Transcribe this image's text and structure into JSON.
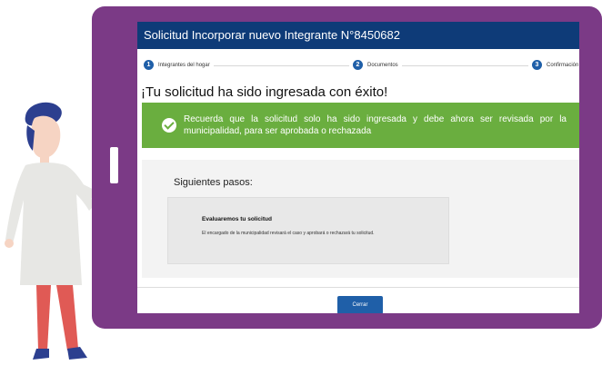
{
  "window": {
    "title": "Solicitud Incorporar nuevo Integrante N°8450682"
  },
  "stepper": {
    "steps": [
      {
        "number": "1",
        "label": "Integrantes del hogar"
      },
      {
        "number": "2",
        "label": "Documentos"
      },
      {
        "number": "3",
        "label": "Confirmación"
      }
    ]
  },
  "main": {
    "headline": "¡Tu solicitud ha sido ingresada con éxito!",
    "alert_text": "Recuerda que la solicitud solo ha sido ingresada y debe ahora ser revisada por la municipalidad, para ser aprobada o rechazada",
    "next_steps_title": "Siguientes pasos:",
    "card": {
      "title": "Evaluaremos tu solicitud",
      "text": "El encargado de la municipalidad revisará el caso y aprobará o rechazará tu solicitud."
    }
  },
  "footer": {
    "close_label": "Cerrar"
  },
  "colors": {
    "tablet": "#7b3a86",
    "titlebar": "#0e3b78",
    "success": "#6aae3f",
    "step_accent": "#1f5fa8"
  },
  "icons": [
    "check-circle-icon"
  ]
}
